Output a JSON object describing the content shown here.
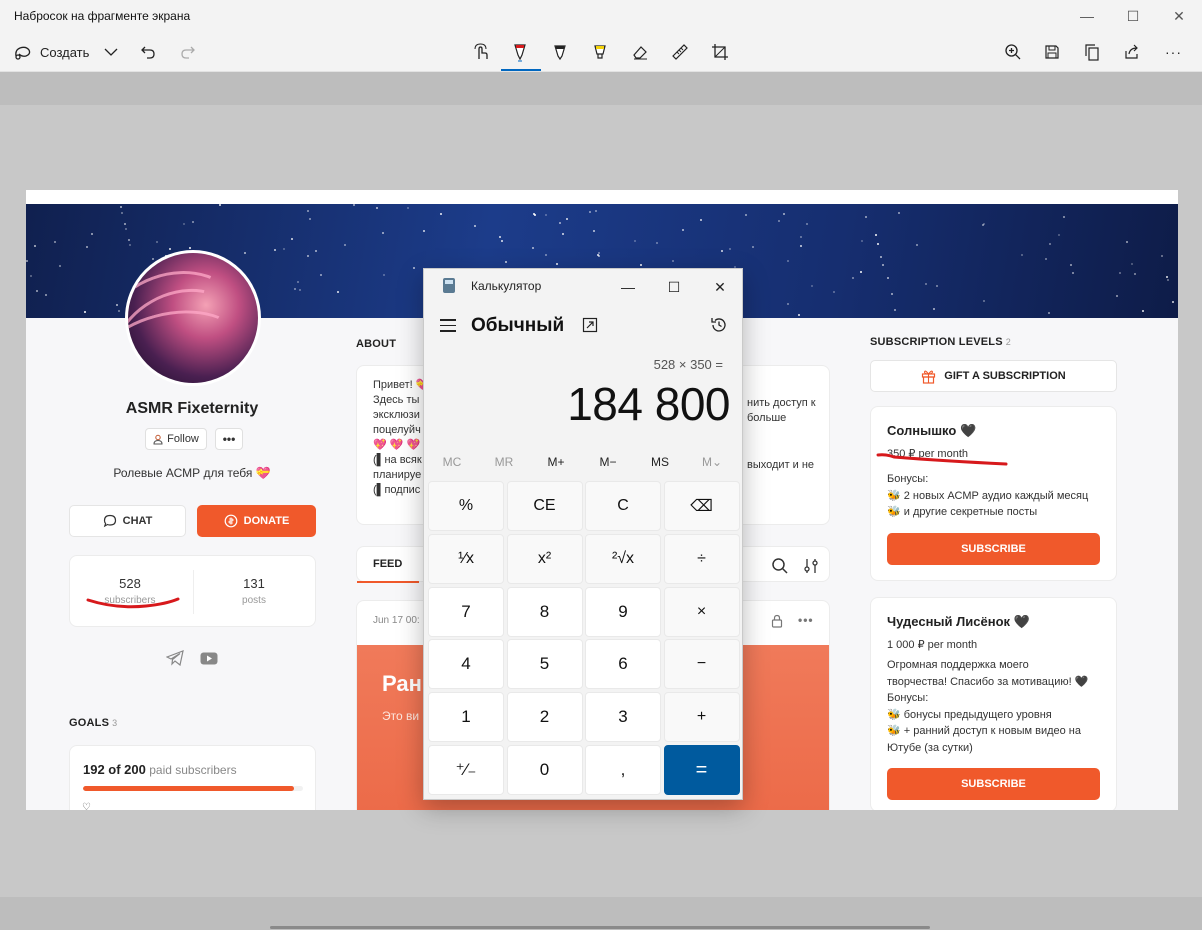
{
  "window": {
    "title": "Набросок на фрагменте экрана",
    "minimize": "—",
    "maximize": "☐",
    "close": "✕"
  },
  "toolbar": {
    "create_label": "Создать",
    "more_label": "···"
  },
  "profile": {
    "name": "ASMR Fixeternity",
    "follow_label": "Follow",
    "more_label": "•••",
    "tagline": "Ролевые АСМР для тебя 💝",
    "chat_label": "CHAT",
    "donate_label": "DONATE",
    "subscribers_count": "528",
    "subscribers_label": "subscribers",
    "posts_count": "131",
    "posts_label": "posts"
  },
  "goals": {
    "header": "GOALS",
    "count": "3",
    "progress_value": "192 of 200",
    "progress_unit": "paid subscribers",
    "progress_fraction": 0.96,
    "heart": "♡"
  },
  "about": {
    "header": "ABOUT",
    "lines": [
      "Привет! 💝",
      "Здесь ты",
      "эксклюзи",
      "поцелуйч",
      "💖 💖 💖",
      "(▌на всяк",
      "планируе",
      "(▌подпис"
    ],
    "right_lines": [
      "нить доступ к",
      "больше"
    ],
    "right_lines2": [
      "выходит и не"
    ]
  },
  "feed": {
    "tab_label": "FEED",
    "post_date": "Jun 17 00:",
    "post_title": "Ран",
    "post_sub": "Это ви"
  },
  "subscriptions": {
    "header": "SUBSCRIPTION LEVELS",
    "count": "2",
    "gift_label": "GIFT A SUBSCRIPTION",
    "tiers": [
      {
        "name": "Солнышко 🖤",
        "price": "350 ₽ per month",
        "body": [
          "Бонусы:",
          "🐝 2 новых АСМР аудио каждый месяц",
          "🐝 и другие секретные посты"
        ],
        "button": "SUBSCRIBE"
      },
      {
        "name": "Чудесный Лисёнок 🖤",
        "price": "1 000 ₽ per month",
        "body": [
          "Огромная поддержка моего",
          "творчества! Спасибо за мотивацию! 🖤",
          "Бонусы:",
          "🐝 бонусы предыдущего уровня",
          "🐝 + ранний доступ к новым видео на",
          "Ютубе (за сутки)"
        ],
        "button": "SUBSCRIBE"
      }
    ]
  },
  "calculator": {
    "title": "Калькулятор",
    "mode": "Обычный",
    "expression": "528 × 350 =",
    "result": "184 800",
    "memory": [
      "MC",
      "MR",
      "M+",
      "M−",
      "MS",
      "M⌄"
    ],
    "keys": [
      [
        "%",
        "CE",
        "C",
        "⌫"
      ],
      [
        "¹⁄x",
        "x²",
        "²√x",
        "÷"
      ],
      [
        "7",
        "8",
        "9",
        "×"
      ],
      [
        "4",
        "5",
        "6",
        "−"
      ],
      [
        "1",
        "2",
        "3",
        "+"
      ],
      [
        "⁺⁄₋",
        "0",
        ",",
        "="
      ]
    ]
  },
  "colors": {
    "accent": "#f0592b",
    "calc_equals": "#005a9e",
    "annotation": "#d7191c"
  }
}
